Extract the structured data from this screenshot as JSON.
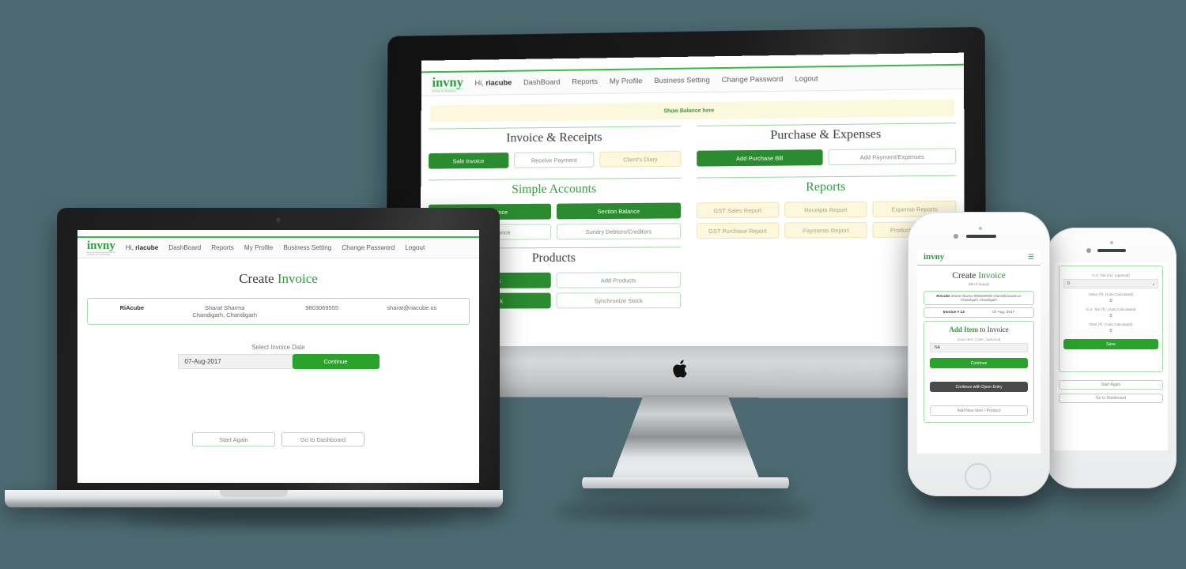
{
  "colors": {
    "background": "#4d6a72",
    "brand_green": "#2f9e3a",
    "button_green": "#2a8b2f",
    "cream": "#fdf7dd",
    "dark_button": "#4a4a4a"
  },
  "brand": {
    "name": "invny",
    "tagline": "invoice & inventory"
  },
  "desktop": {
    "device": "imac",
    "nav": {
      "greeting_prefix": "Hi, ",
      "user": "riacube",
      "links": [
        "DashBoard",
        "Reports",
        "My Profile",
        "Business Setting",
        "Change Password",
        "Logout"
      ]
    },
    "balance_bar": "Show Balance here",
    "sections": [
      {
        "title": "Invoice & Receipts",
        "style": "dark",
        "rows": [
          [
            {
              "label": "Sale Invoice",
              "style": "green"
            },
            {
              "label": "Receive Payment",
              "style": "outline"
            },
            {
              "label": "Client's Diary",
              "style": "cream"
            }
          ]
        ]
      },
      {
        "title": "Purchase & Expenses",
        "style": "dark",
        "rows": [
          [
            {
              "label": "Add Purchase Bill",
              "style": "green"
            },
            {
              "label": "Add Payment/Expenses",
              "style": "outline"
            }
          ]
        ]
      },
      {
        "title": "Simple Accounts",
        "style": "green",
        "rows": [
          [
            {
              "label": "Head Balance",
              "style": "green"
            },
            {
              "label": "Section Balance",
              "style": "green"
            }
          ],
          [
            {
              "label": "Section Balance",
              "style": "outline"
            },
            {
              "label": "Sundry Debtors/Creditors",
              "style": "outline"
            }
          ]
        ]
      },
      {
        "title": "Reports",
        "style": "green",
        "rows": [
          [
            {
              "label": "GST Sales Report",
              "style": "cream"
            },
            {
              "label": "Receipts Report",
              "style": "cream"
            },
            {
              "label": "Expense Reports",
              "style": "cream"
            }
          ],
          [
            {
              "label": "GST Purchase Report",
              "style": "cream"
            },
            {
              "label": "Payments Report",
              "style": "cream"
            },
            {
              "label": "Product Stock List",
              "style": "cream"
            }
          ]
        ]
      },
      {
        "title": "Products",
        "style": "dark",
        "rows": [
          [
            {
              "label": "Products",
              "style": "green"
            },
            {
              "label": "Add Products",
              "style": "outline"
            }
          ],
          [
            {
              "label": "New Stock",
              "style": "green"
            },
            {
              "label": "Synchronize Stock",
              "style": "outline"
            }
          ]
        ]
      }
    ]
  },
  "laptop": {
    "device": "macbook",
    "nav": {
      "greeting_prefix": "Hi, ",
      "user": "riacube",
      "links": [
        "DashBoard",
        "Reports",
        "My Profile",
        "Business Setting",
        "Change Password",
        "Logout"
      ]
    },
    "title_prefix": "Create ",
    "title_accent": "Invoice",
    "client": {
      "company": "RiAcube",
      "contact": "Sharat Sharma",
      "phone": "9803069555",
      "email": "sharat@riacube.us",
      "address": "Chandigarh, Chandigarh"
    },
    "date_label": "Select Invoice Date",
    "date_value": "07-Aug-2017",
    "continue_label": "Continue",
    "footer_buttons": [
      {
        "label": "Start Again",
        "style": "outline"
      },
      {
        "label": "Go to Dashboard",
        "style": "gray"
      }
    ]
  },
  "phone_main": {
    "device": "iphone",
    "menu_icon": "hamburger-icon",
    "title_prefix": "Create ",
    "title_accent": "Invoice",
    "subtitle": "Bill of Supply",
    "client": {
      "company": "RiAcube",
      "line1": "Sharat Sharma 9803069555 sharat@riacube.us",
      "line2": "Chandigarh, Chandigarh"
    },
    "invoice_no_label": "Invoice # 13",
    "invoice_date": "07 Aug, 2017",
    "add_item_prefix": "Add Item",
    "add_item_suffix": " to Invoice",
    "scan_label": "Scan Item Code: (optional)",
    "scan_value": "NA",
    "continue_label": "Continue",
    "open_entry_label": "Continue with Open Entry",
    "add_new_label": "Add New Item / Product"
  },
  "phone_second": {
    "device": "iphone",
    "fields": [
      {
        "label": "G.S. Tax (%): (optional)",
        "value": "0",
        "type": "select"
      },
      {
        "label": "Value (₹): (Auto Calculated)",
        "value": "0",
        "type": "readonly"
      },
      {
        "label": "G.S. Tax (₹): (Auto Calculated)",
        "value": "0",
        "type": "readonly"
      },
      {
        "label": "Total (₹): (Auto Calculated)",
        "value": "0",
        "type": "readonly"
      }
    ],
    "save_label": "Save",
    "footer_buttons": [
      {
        "label": "Start Again",
        "style": "outline"
      },
      {
        "label": "Go to Dashboard",
        "style": "gray"
      }
    ]
  }
}
